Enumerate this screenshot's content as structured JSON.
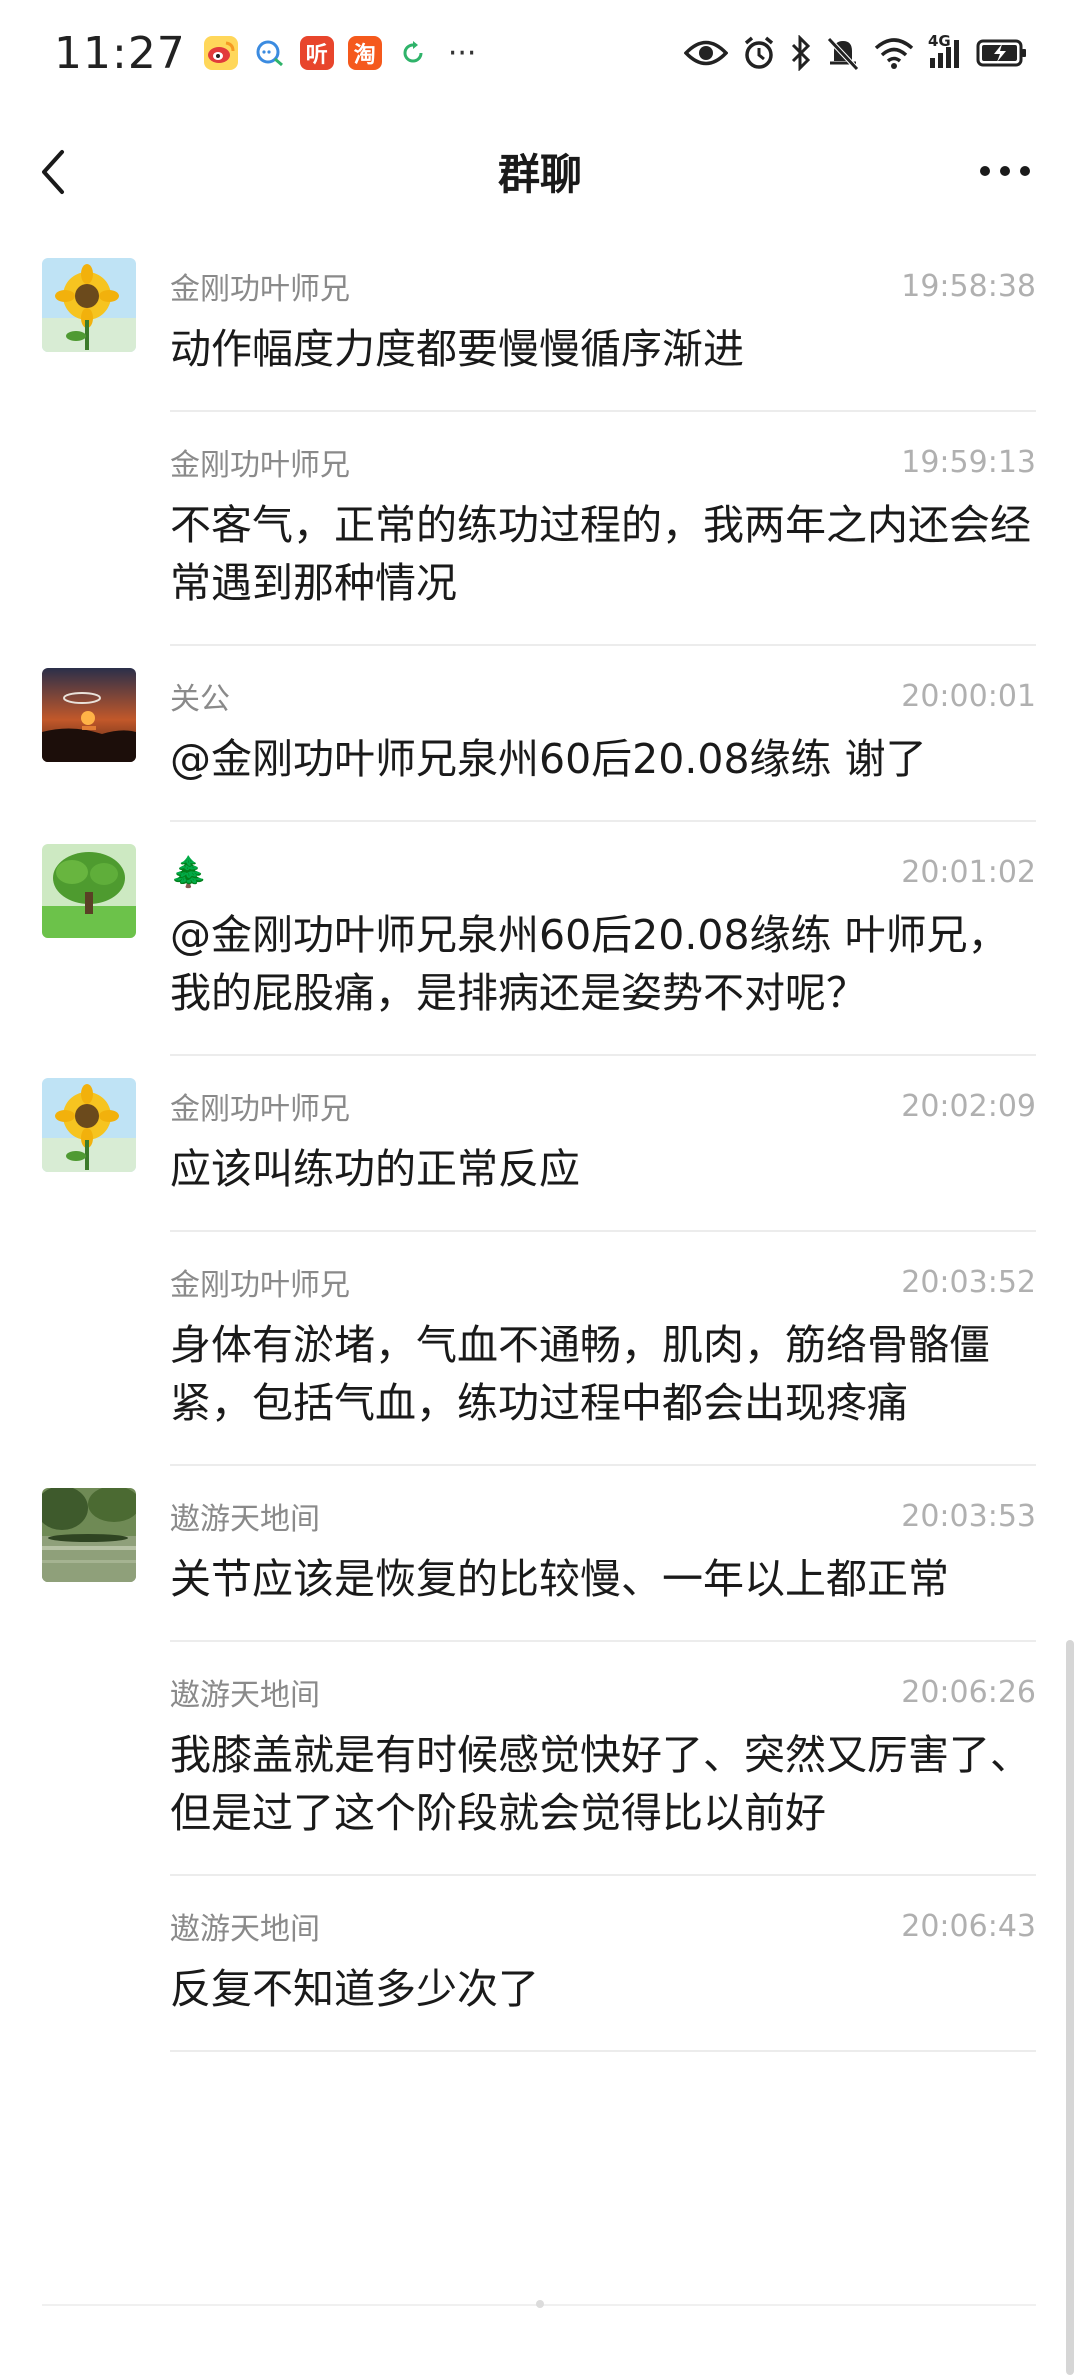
{
  "status": {
    "time": "11:27",
    "apps": [
      {
        "icon": "weibo-icon",
        "color": "#f5c242",
        "glyph": "微"
      },
      {
        "icon": "chat-bubble-icon",
        "color": "#ffffff",
        "glyph": "Q"
      },
      {
        "icon": "listen-app-icon",
        "color": "#e8452c",
        "glyph": "听"
      },
      {
        "icon": "taobao-icon",
        "color": "#f5591c",
        "glyph": "淘"
      },
      {
        "icon": "refresh-icon",
        "color": "#ffffff",
        "glyph": "C"
      }
    ],
    "more": "···",
    "network": "4G"
  },
  "nav": {
    "title": "群聊"
  },
  "messages": [
    {
      "sender": "金刚功叶师兄",
      "time": "19:58:38",
      "text": "动作幅度力度都要慢慢循序渐进",
      "avatar": "sunflower-avatar"
    },
    {
      "sender": "金刚功叶师兄",
      "time": "19:59:13",
      "text": "不客气，正常的练功过程的，我两年之内还会经常遇到那种情况",
      "avatar": ""
    },
    {
      "sender": "关公",
      "time": "20:00:01",
      "text": "@金刚功叶师兄泉州60后20.08缘练 谢了",
      "avatar": "sunset-avatar"
    },
    {
      "sender": "🌲",
      "time": "20:01:02",
      "text": "@金刚功叶师兄泉州60后20.08缘练 叶师兄，我的屁股痛，是排病还是姿势不对呢？",
      "avatar": "tree-avatar"
    },
    {
      "sender": "金刚功叶师兄",
      "time": "20:02:09",
      "text": "应该叫练功的正常反应",
      "avatar": "sunflower-avatar"
    },
    {
      "sender": "金刚功叶师兄",
      "time": "20:03:52",
      "text": "身体有淤堵，气血不通畅，肌肉，筋络骨骼僵紧，包括气血，练功过程中都会出现疼痛",
      "avatar": ""
    },
    {
      "sender": "遨游天地间",
      "time": "20:03:53",
      "text": "关节应该是恢复的比较慢、一年以上都正常",
      "avatar": "pond-avatar"
    },
    {
      "sender": "遨游天地间",
      "time": "20:06:26",
      "text": "我膝盖就是有时候感觉快好了、突然又厉害了、但是过了这个阶段就会觉得比以前好",
      "avatar": ""
    },
    {
      "sender": "遨游天地间",
      "time": "20:06:43",
      "text": "反复不知道多少次了",
      "avatar": ""
    }
  ]
}
